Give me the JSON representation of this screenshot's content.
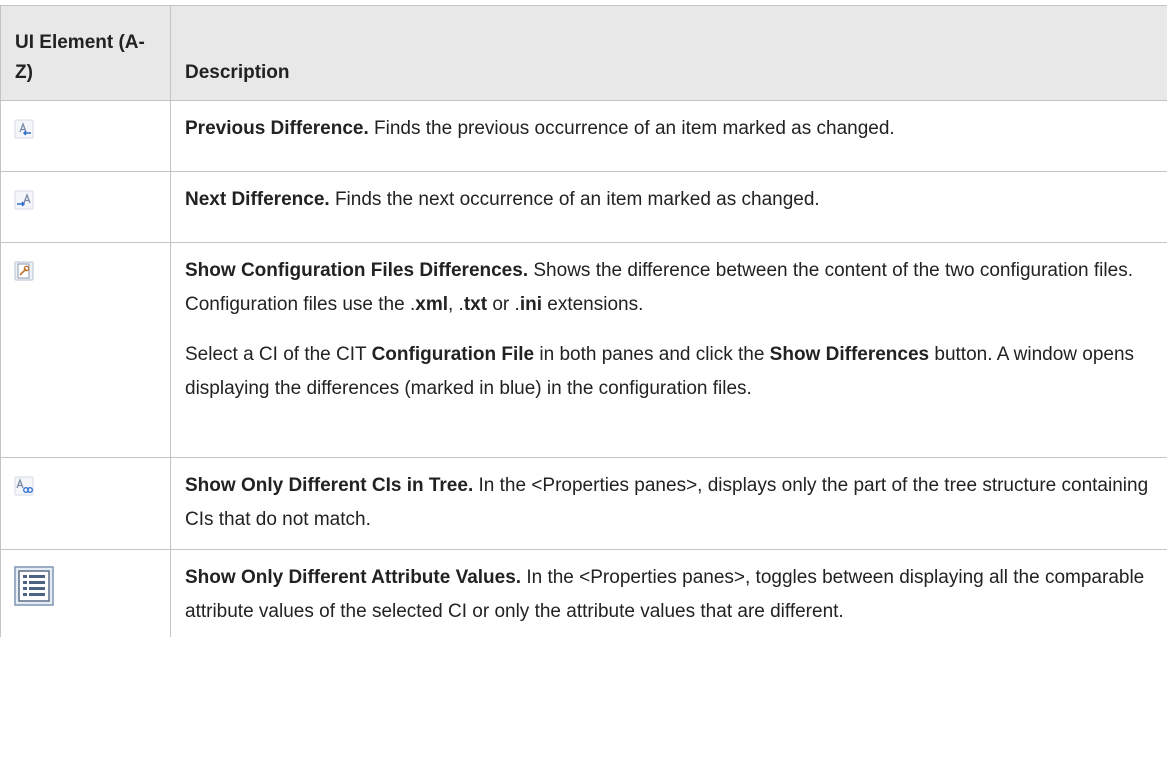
{
  "header": {
    "col1": "UI Element (A-Z)",
    "col2": "Description"
  },
  "rows": [
    {
      "icon": "previous-difference-icon",
      "title": "Previous Difference.",
      "text": " Finds the previous occurrence of an item marked as changed."
    },
    {
      "icon": "next-difference-icon",
      "title": "Next Difference.",
      "text": " Finds the next occurrence of an item marked as changed."
    },
    {
      "icon": "show-config-file-differences-icon",
      "title": "Show Configuration Files Differences.",
      "p1_text1": " Shows the difference between the content of the two configuration files. Configuration files use the .",
      "p1_xml": "xml",
      "p1_sep1": ", .",
      "p1_txt": "txt",
      "p1_sep2": " or .",
      "p1_ini": "ini",
      "p1_end": " extensions.",
      "p2_text1": "Select a CI of the CIT ",
      "p2_bold1": "Configuration File",
      "p2_text2": " in both panes and click the ",
      "p2_bold2": "Show Differences",
      "p2_text3": " button. A window opens displaying the differences (marked in blue) in the configuration files."
    },
    {
      "icon": "show-only-different-cis-icon",
      "title": "Show Only Different CIs in Tree.",
      "text": " In the <Properties panes>, displays only the part of the tree structure containing CIs that do not match."
    },
    {
      "icon": "show-only-different-attributes-icon",
      "title": "Show Only Different Attribute Values.",
      "text": " In the <Properties panes>, toggles between displaying all the comparable attribute values of the selected CI or only the attribute values that are different."
    }
  ]
}
